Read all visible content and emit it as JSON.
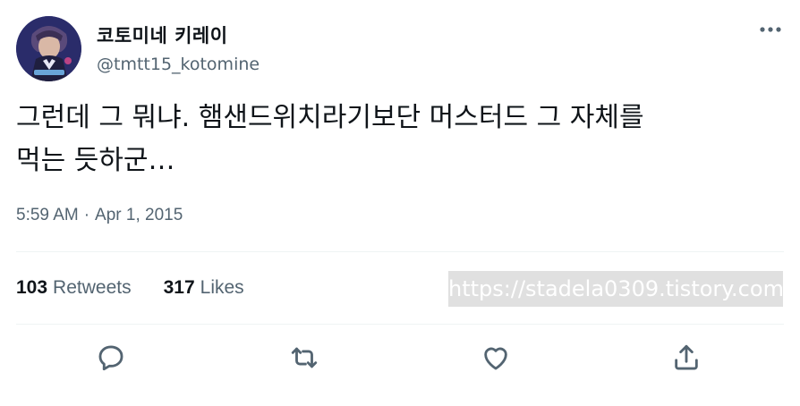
{
  "author": {
    "display_name": "코토미네 키레이",
    "handle": "@tmtt15_kotomine",
    "avatar_icon": "profile-avatar"
  },
  "tweet": {
    "text": "그런데 그 뭐냐. 햄샌드위치라기보단 머스터드 그 자체를\n먹는 듯하군…",
    "time": "5:59 AM",
    "separator": "·",
    "date": "Apr 1, 2015"
  },
  "stats": {
    "retweets_count": "103",
    "retweets_label": "Retweets",
    "likes_count": "317",
    "likes_label": "Likes"
  },
  "watermark": "https://stadela0309.tistory.com",
  "actions": {
    "reply_icon": "reply-icon",
    "retweet_icon": "retweet-icon",
    "like_icon": "heart-icon",
    "share_icon": "share-icon"
  },
  "colors": {
    "text_primary": "#0f1419",
    "text_secondary": "#536471",
    "divider": "#eff3f4"
  }
}
